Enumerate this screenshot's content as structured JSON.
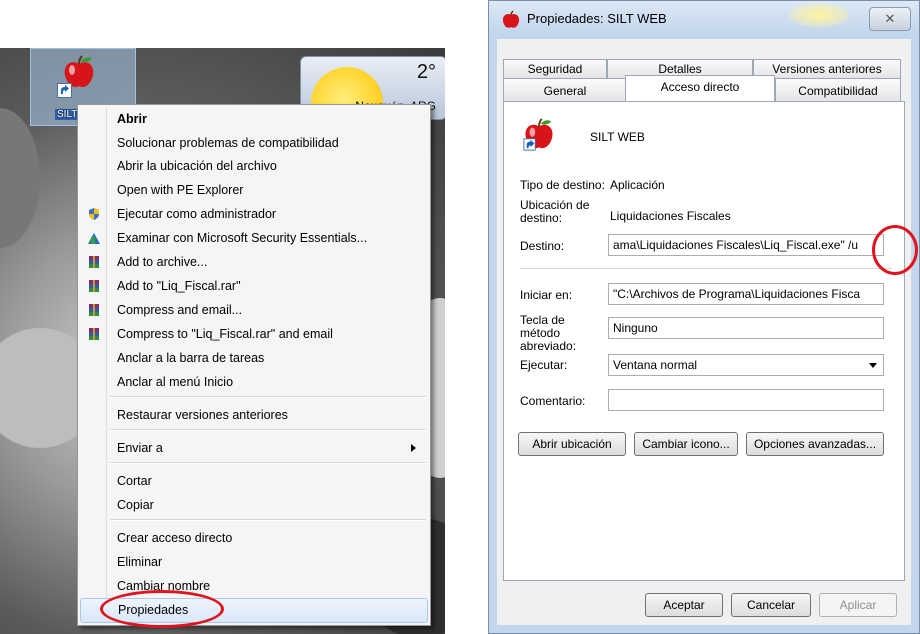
{
  "desktop": {
    "icon_label": "SILT",
    "weather": {
      "temperature": "2°",
      "location": "Neuquén, ARG"
    }
  },
  "context_menu": {
    "items": [
      {
        "label": "Abrir",
        "bold": true,
        "icon": ""
      },
      {
        "label": "Solucionar problemas de compatibilidad",
        "icon": ""
      },
      {
        "label": "Abrir la ubicación del archivo",
        "icon": ""
      },
      {
        "label": "Open with PE Explorer",
        "icon": ""
      },
      {
        "label": "Ejecutar como administrador",
        "icon": "uac-shield-icon"
      },
      {
        "label": "Examinar con Microsoft Security Essentials...",
        "icon": "security-essentials-icon"
      },
      {
        "label": "Add to archive...",
        "icon": "winrar-icon"
      },
      {
        "label": "Add to \"Liq_Fiscal.rar\"",
        "icon": "winrar-icon"
      },
      {
        "label": "Compress and email...",
        "icon": "winrar-icon"
      },
      {
        "label": "Compress to \"Liq_Fiscal.rar\" and email",
        "icon": "winrar-icon"
      },
      {
        "label": "Anclar a la barra de tareas",
        "icon": ""
      },
      {
        "label": "Anclar al menú Inicio",
        "icon": ""
      },
      {
        "label": "Restaurar versiones anteriores",
        "icon": ""
      },
      {
        "label": "Enviar a",
        "icon": "",
        "submenu": true
      },
      {
        "label": "Cortar",
        "icon": ""
      },
      {
        "label": "Copiar",
        "icon": ""
      },
      {
        "label": "Crear acceso directo",
        "icon": ""
      },
      {
        "label": "Eliminar",
        "icon": ""
      },
      {
        "label": "Cambiar nombre",
        "icon": ""
      },
      {
        "label": "Propiedades",
        "icon": "",
        "highlighted": true
      }
    ]
  },
  "dialog": {
    "title": "Propiedades: SILT WEB",
    "close_glyph": "✕",
    "tabs_row1": [
      "Seguridad",
      "Detalles",
      "Versiones anteriores"
    ],
    "tabs_row2": [
      "General",
      "Acceso directo",
      "Compatibilidad"
    ],
    "active_tab": "Acceso directo",
    "shortcut_name": "SILT WEB",
    "fields": {
      "target_type_label": "Tipo de destino:",
      "target_type_value": "Aplicación",
      "target_location_label": "Ubicación de destino:",
      "target_location_value": "Liquidaciones Fiscales",
      "target_label": "Destino:",
      "target_value": "ama\\Liquidaciones Fiscales\\Liq_Fiscal.exe\" /u",
      "start_in_label": "Iniciar en:",
      "start_in_value": "\"C:\\Archivos de Programa\\Liquidaciones Fisca",
      "shortcut_key_label": "Tecla de método abreviado:",
      "shortcut_key_value": "Ninguno",
      "run_label": "Ejecutar:",
      "run_value": "Ventana normal",
      "comment_label": "Comentario:",
      "comment_value": ""
    },
    "buttons": {
      "open_location": "Abrir ubicación",
      "change_icon": "Cambiar icono...",
      "advanced": "Opciones avanzadas...",
      "ok": "Aceptar",
      "cancel": "Cancelar",
      "apply": "Aplicar"
    }
  },
  "colors": {
    "highlight_ellipse": "#e0141e"
  }
}
